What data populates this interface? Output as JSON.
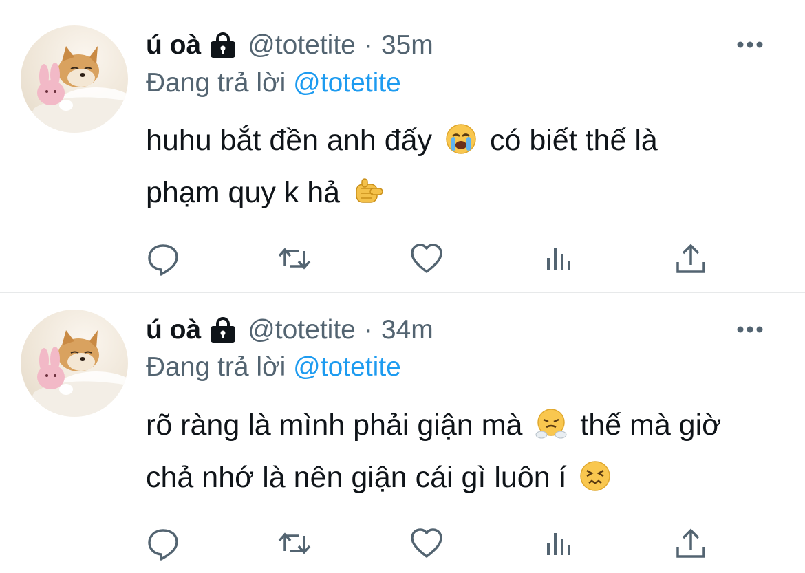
{
  "colors": {
    "text": "#0f1419",
    "secondary": "#536471",
    "link": "#1d9bf0",
    "divider": "#e7e9ea",
    "background": "#ffffff"
  },
  "tweets": [
    {
      "display_name": "ú oà",
      "handle": "@totetite",
      "separator": "·",
      "time": "35m",
      "reply_prefix": "Đang trả lời",
      "reply_to": "@totetite",
      "lines": [
        {
          "parts": [
            "huhu bắt đền anh đấy",
            "có biết thế là"
          ],
          "emoji": "loudly-crying-face-emoji"
        },
        {
          "parts": [
            "phạm quy k hả"
          ],
          "emoji": "backhand-index-pointing-emoji"
        }
      ],
      "icons": {
        "lock": "lock-icon",
        "more": "more-icon",
        "actions": [
          "reply-icon",
          "retweet-icon",
          "like-icon",
          "views-icon",
          "share-icon"
        ]
      }
    },
    {
      "display_name": "ú oà",
      "handle": "@totetite",
      "separator": "·",
      "time": "34m",
      "reply_prefix": "Đang trả lời",
      "reply_to": "@totetite",
      "lines": [
        {
          "parts": [
            "rõ ràng là mình phải giận mà",
            "thế mà giờ"
          ],
          "emoji": "face-with-steam-emoji"
        },
        {
          "parts": [
            "chả nhớ là nên giận cái gì luôn í"
          ],
          "emoji": "confounded-face-emoji"
        }
      ],
      "icons": {
        "lock": "lock-icon",
        "more": "more-icon",
        "actions": [
          "reply-icon",
          "retweet-icon",
          "like-icon",
          "views-icon",
          "share-icon"
        ]
      }
    }
  ]
}
